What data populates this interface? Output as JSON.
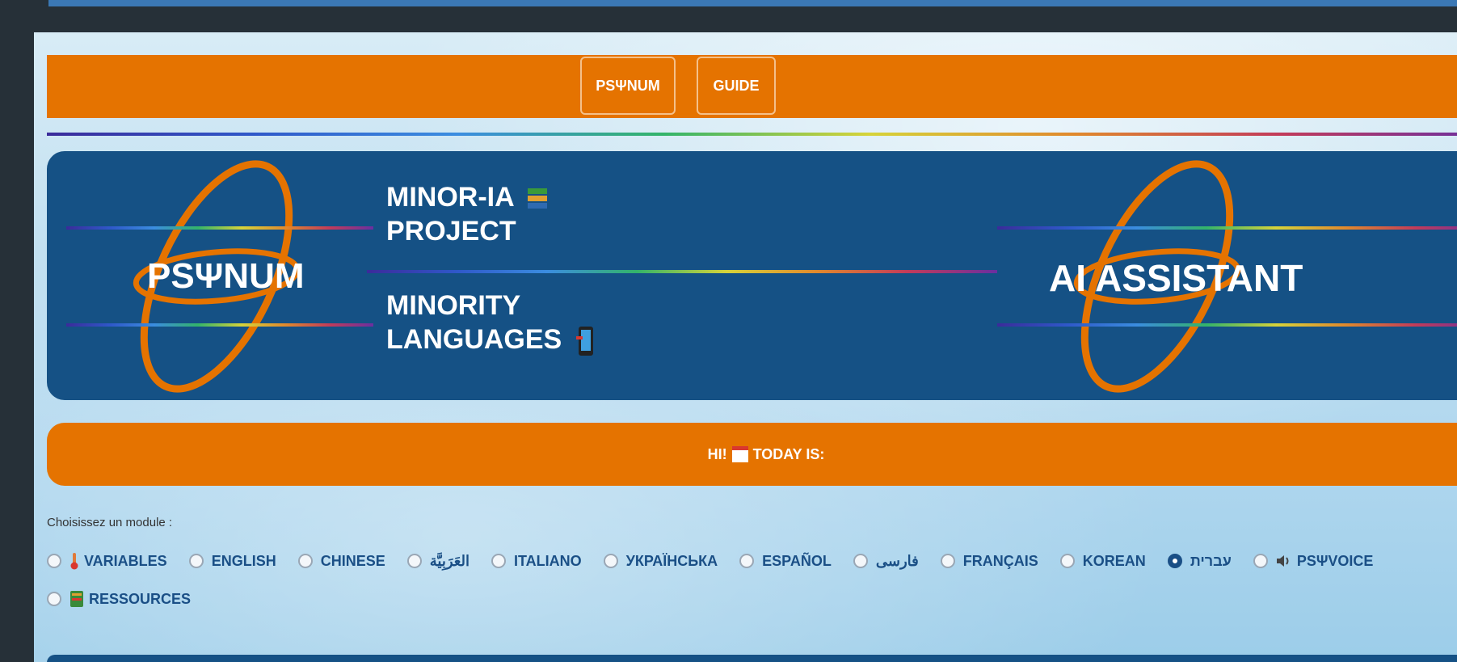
{
  "nav": {
    "buttons": [
      {
        "label": "PSΨNUM"
      },
      {
        "label": "GUIDE"
      }
    ]
  },
  "banner": {
    "left_brand": "PSΨNUM",
    "project_line1": "MINOR-IA",
    "project_line2": "PROJECT",
    "languages_line1": "MINORITY",
    "languages_line2": "LANGUAGES",
    "right_brand": "AI ASSISTANT",
    "icons": [
      "books-icon",
      "phone-icon"
    ]
  },
  "greeting": {
    "text": "HI!",
    "today": "TODAY IS:"
  },
  "module_prompt": "Choisissez un module :",
  "modules": [
    {
      "label": "VARIABLES",
      "icon": "thermometer-icon",
      "selected": false
    },
    {
      "label": "ENGLISH",
      "selected": false
    },
    {
      "label": "CHINESE",
      "selected": false
    },
    {
      "label": "العَرَبِيَّة",
      "selected": false
    },
    {
      "label": "ITALIANO",
      "selected": false
    },
    {
      "label": "УКРАЇНСЬКА",
      "selected": false
    },
    {
      "label": "ESPAÑOL",
      "selected": false
    },
    {
      "label": "فارسی",
      "selected": false
    },
    {
      "label": "FRANÇAIS",
      "selected": false
    },
    {
      "label": "KOREAN",
      "selected": false
    },
    {
      "label": "עברית",
      "selected": true
    },
    {
      "label": "PSΨVOICE",
      "icon": "speaker-icon",
      "selected": false
    },
    {
      "label": "RESSOURCES",
      "icon": "book-icon",
      "selected": false
    }
  ],
  "colors": {
    "orange": "#e57300",
    "navy": "#155185",
    "link_blue": "#1a4f86"
  }
}
